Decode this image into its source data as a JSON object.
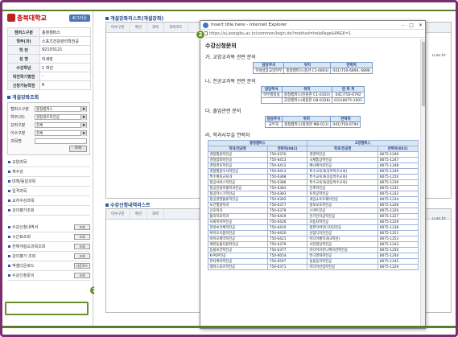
{
  "sidebar": {
    "logo_text": "충북대학교",
    "logout_label": "로그아웃",
    "info": [
      {
        "k": "캠퍼스구분",
        "v": "충청캠퍼스"
      },
      {
        "k": "학부(과)",
        "v": "스포츠건강관리학전공"
      },
      {
        "k": "학  번",
        "v": "92103121"
      },
      {
        "k": "성  명",
        "v": "이세란"
      },
      {
        "k": "수강학년",
        "v": "1 학년"
      },
      {
        "k": "직전학기평점",
        "v": "-"
      },
      {
        "k": "신청가능학점",
        "v": "6"
      }
    ],
    "section_title": "개설강좌조회",
    "filters": [
      {
        "label": "캠퍼스구분",
        "value": "충청캠퍼스"
      },
      {
        "label": "학부(과)",
        "value": "경찰경호학전공"
      },
      {
        "label": "강좌구분",
        "value": "전체"
      },
      {
        "label": "이수구분",
        "value": "전체"
      },
      {
        "label": "과목명",
        "value": ""
      }
    ],
    "filter_btn": "조회",
    "menu1": [
      "교양과목",
      "재수강",
      "대체/동일과목",
      "일격과목",
      "교차수강과목",
      "강의평가조회"
    ],
    "menu2": [
      {
        "label": "수강신청내역서",
        "btn": "조회"
      },
      {
        "label": "시간표조회",
        "btn": "조회"
      },
      {
        "label": "전체개설교과목조회",
        "btn": "조회"
      },
      {
        "label": "강의평가 조회",
        "btn": "조회"
      },
      {
        "label": "엑셀다운로드",
        "btn": "다운로드"
      },
      {
        "label": "수강신청문의",
        "btn": "조회"
      }
    ]
  },
  "main": {
    "top_panel_title": "개설강좌리스트(개설강좌)",
    "top_cols": [
      "이수구분",
      "학년",
      "과목",
      "과목코드"
    ],
    "bottom_panel_title": "수강신청내역리스트",
    "bottom_cols": [
      "이수구분",
      "학년",
      "과목"
    ],
    "edge_text": "u.ac.kr"
  },
  "popup": {
    "title": "Insert title here - Internet Explorer",
    "url": "https://sj.joongbu.ac.kr/common/login.do?method=helpPage&PAGE=1",
    "heading": "수강신청문의",
    "sec_ga": "가. 교양교과목 관련 문의",
    "ga_headers": [
      "담당부서",
      "위치",
      "연락처"
    ],
    "ga_row": [
      "학생성장교양학부",
      "충청캠퍼스(충관 C1-0803)",
      "041)750-6894, 6898"
    ],
    "sec_na": "나. 전공교과목 관련 문의",
    "na_headers": [
      "담당부서",
      "위치",
      "연 락 처"
    ],
    "na_rows": [
      [
        "학부행정실",
        "충청캠퍼스(진원관 C1-0103)",
        "041)750-6792"
      ],
      [
        "",
        "고양캠퍼스(세종관 G8-0328)",
        "031)8075-1001"
      ]
    ],
    "sec_da": "다. 졸업관련 문의",
    "da_headers": [
      "담당부서",
      "위치",
      "연락처"
    ],
    "da_row": [
      "교무과",
      "충청캠퍼스(창결관 MB-011)",
      "041)750-6794"
    ],
    "sec_ra": "라. 학과사무실 연락처",
    "campus_headers": [
      "충청캠퍼스",
      "고양캠퍼스"
    ],
    "major_headers": [
      "학과/전공명",
      "연락처(041)",
      "학과/전공명",
      "연락처(031)"
    ],
    "majors": [
      [
        "경찰행정학전공",
        "750-6370",
        "경영학전공",
        "8075-1246"
      ],
      [
        "경찰범죄학전공",
        "750-6413",
        "국제통상학전공",
        "8075-1247"
      ],
      [
        "경찰경호학전공",
        "750-6412",
        "애니메이션전공",
        "8075-1248"
      ],
      [
        "경찰행정수사학전공",
        "750-6413",
        "특수교육과(유아특수교육)",
        "8075-1249"
      ],
      [
        "특수체육교육과",
        "750-6368",
        "특수교육과(초등특수교육)",
        "8075-1250"
      ],
      [
        "항공서비스학전공",
        "750-6386",
        "특수교육과(중등특수교육)",
        "8075-1239"
      ],
      [
        "항공관광호텔학과전공",
        "750-6383",
        "건축학전공",
        "8075-1231"
      ],
      [
        "항공마스크학전공",
        "750-6383",
        "토목공학전공",
        "8075-1232"
      ],
      [
        "항공경영물류학전공",
        "750-6392",
        "게임소프트웨어전공",
        "8075-1234"
      ],
      [
        "보건행정학과",
        "750-6377",
        "정보보호학전공",
        "8075-1228"
      ],
      [
        "간호학과",
        "750-6379",
        "스마트전공",
        "8075-1226"
      ],
      [
        "물리치료학과",
        "750-6419",
        "전기전자공학전공",
        "8075-1227"
      ],
      [
        "사회복지학전공",
        "750-6426",
        "자동차학전공",
        "8075-1229"
      ],
      [
        "한방보건체학전공",
        "750-6420",
        "컴퓨터바인디자인전공",
        "8075-1238"
      ],
      [
        "바이오식품학전공",
        "750-6420",
        "산업디자인전공",
        "8075-1251"
      ],
      [
        "바이오제약학전공",
        "750-6421",
        "미디어제작과(3학년)",
        "8075-1253"
      ],
      [
        "애완동물자원학전공",
        "750-6379",
        "사진영상학전공",
        "8075-1243"
      ],
      [
        "동물보건학전공",
        "750-6377",
        "미디어커뮤니케이션학전공",
        "8075-1256"
      ],
      [
        "K-POP전공",
        "750-6654",
        "연극영화학전공",
        "8075-1244"
      ],
      [
        "뷰티케어학전공",
        "750-6597",
        "실용음악학전공",
        "8075-1245"
      ],
      [
        "레저스포츠학전공",
        "750-6371",
        "미디어산업학전공",
        "8075-1229"
      ]
    ]
  },
  "badges": {
    "one": "1",
    "two": "2"
  },
  "colors": {
    "frame": "#7a2e6e",
    "accent_green": "#6b8f2b",
    "brand_blue": "#2b5aa6"
  }
}
